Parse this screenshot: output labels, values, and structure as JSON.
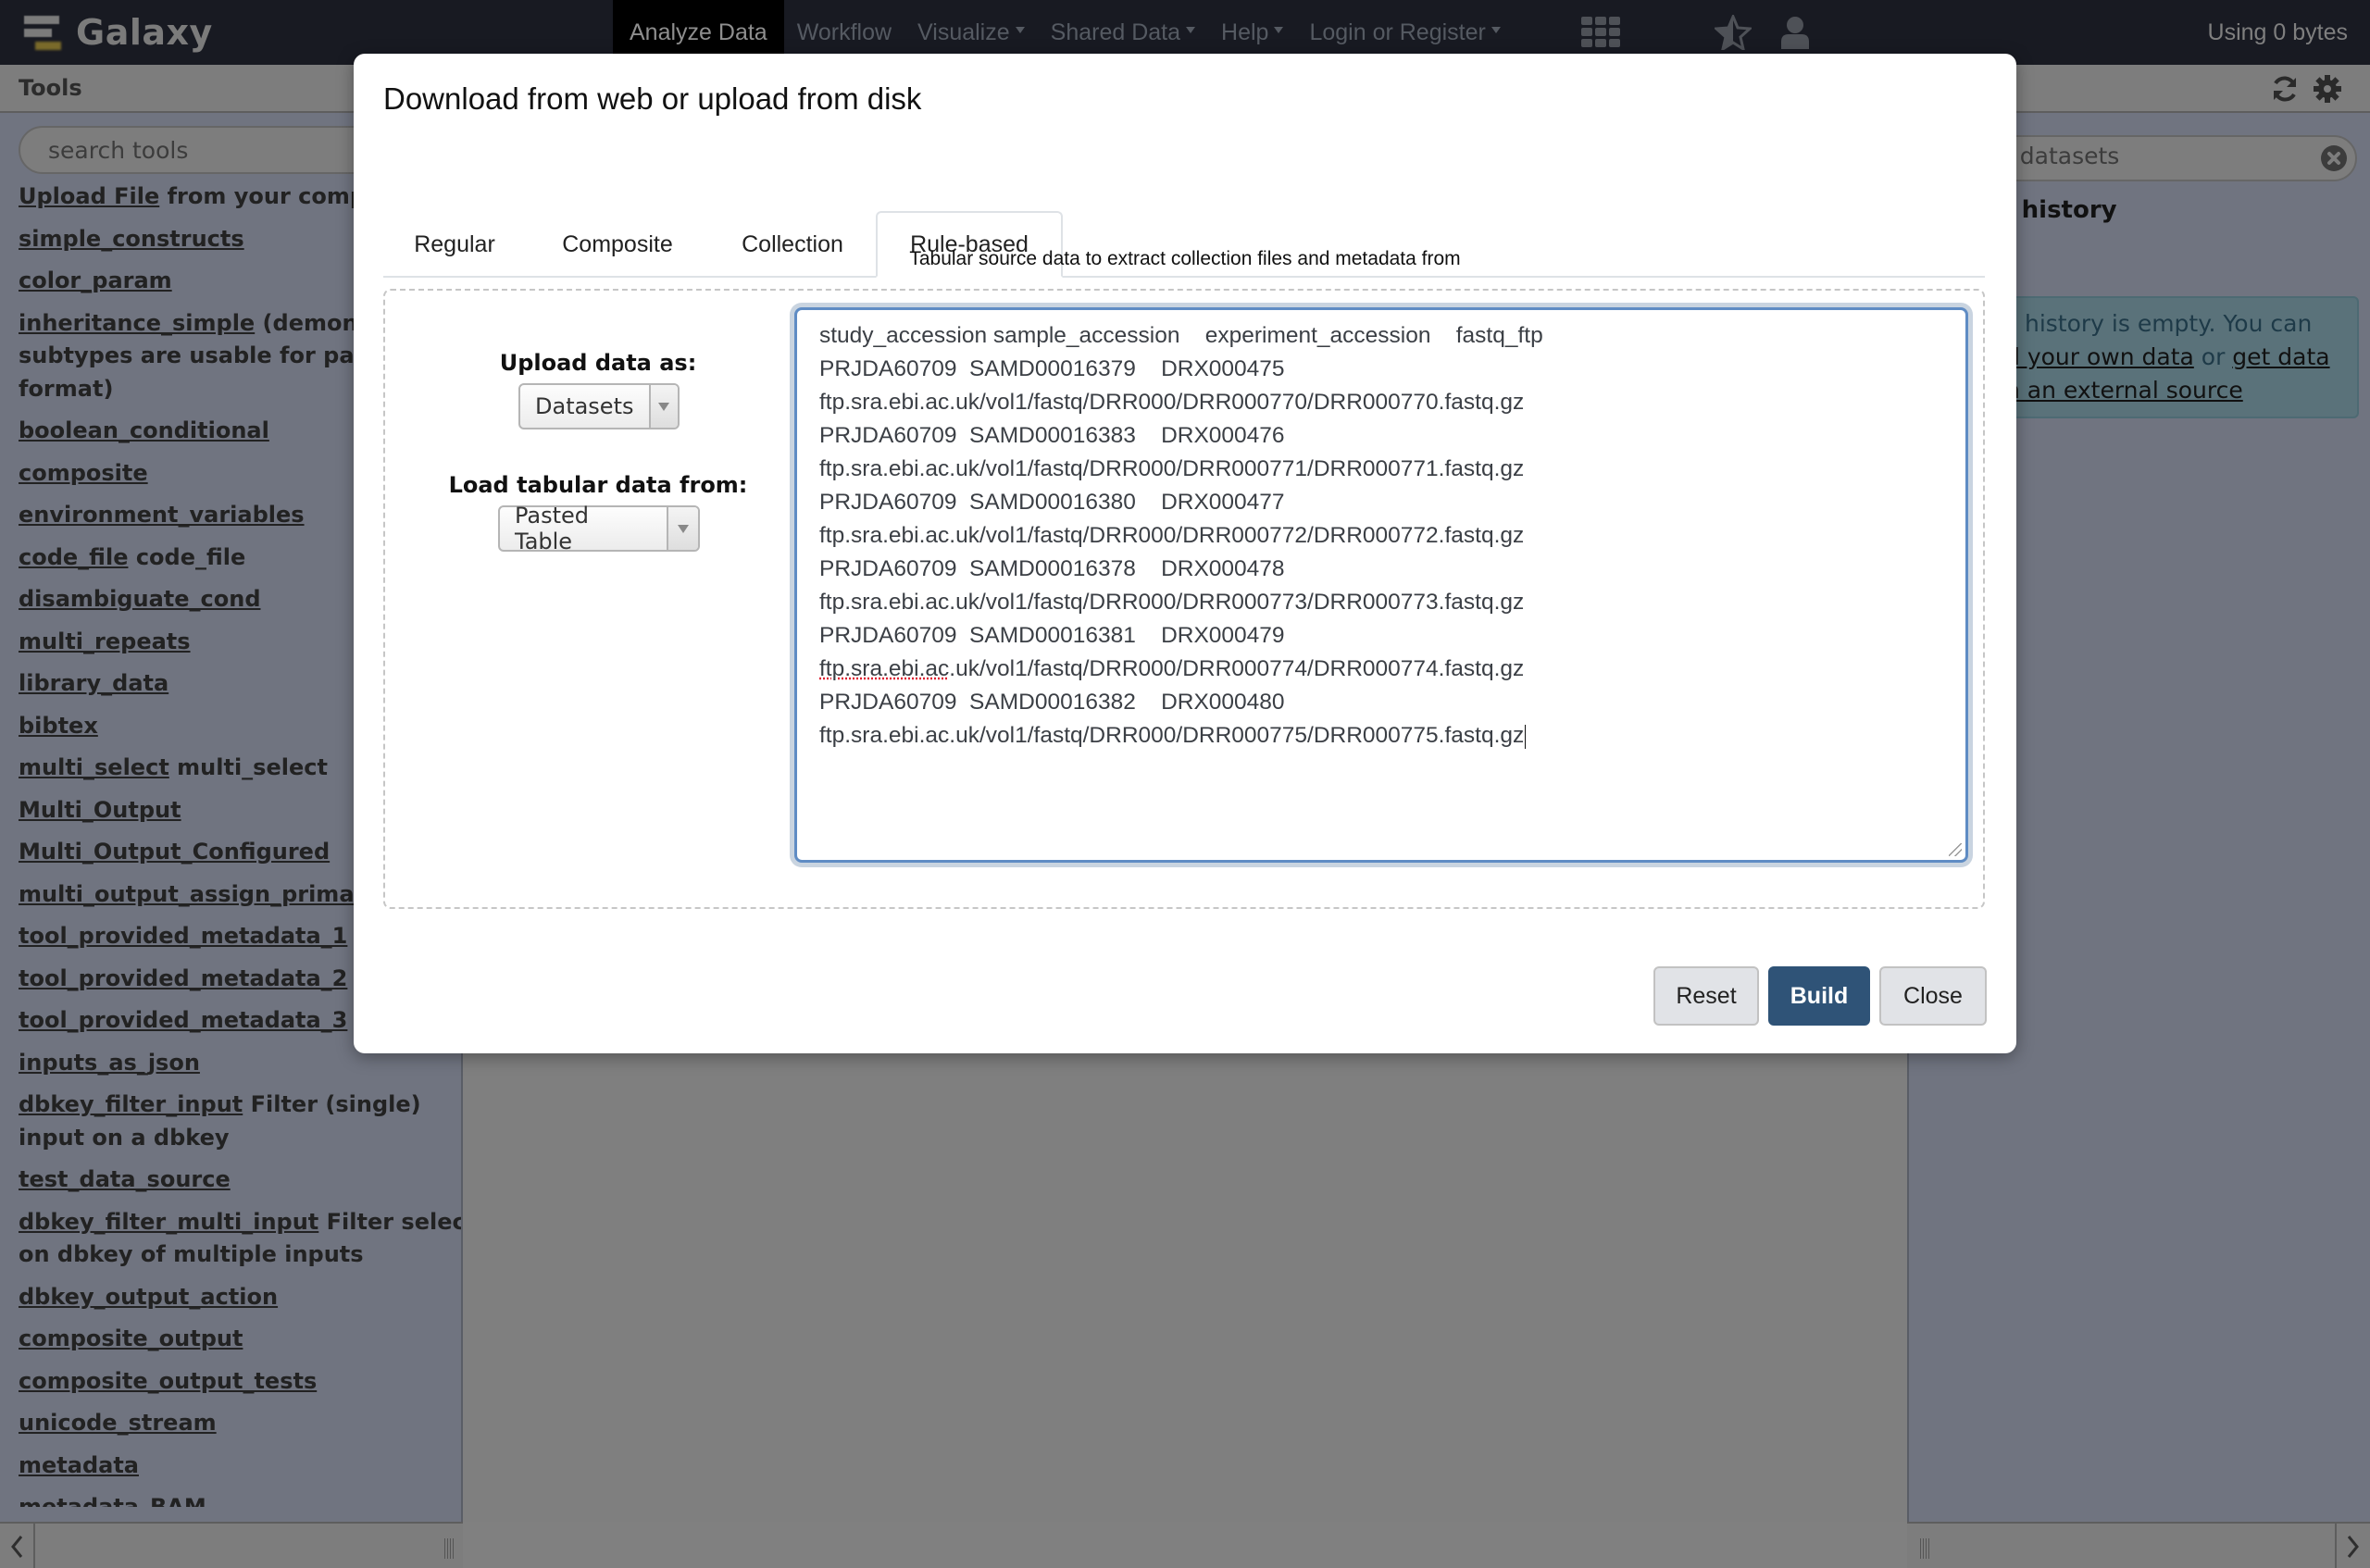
{
  "masthead": {
    "brand": "Galaxy",
    "nav": [
      {
        "label": "Analyze Data",
        "active": true,
        "dropdown": false
      },
      {
        "label": "Workflow",
        "active": false,
        "dropdown": false
      },
      {
        "label": "Visualize",
        "active": false,
        "dropdown": true
      },
      {
        "label": "Shared Data",
        "active": false,
        "dropdown": true
      },
      {
        "label": "Help",
        "active": false,
        "dropdown": true
      },
      {
        "label": "Login or Register",
        "active": false,
        "dropdown": true
      }
    ],
    "icons": [
      "grid-icon",
      "star-icon",
      "user-icon"
    ],
    "quota": "Using 0 bytes"
  },
  "tool_panel": {
    "title": "Tools",
    "search_placeholder": "search tools",
    "items": [
      {
        "link": "Upload File",
        "desc": " from your compu"
      },
      {
        "link": "simple_constructs",
        "desc": ""
      },
      {
        "link": "color_param",
        "desc": ""
      },
      {
        "link": "inheritance_simple",
        "desc": " (demonstr",
        "desc2": "subtypes are usable for parer",
        "desc3": "format)"
      },
      {
        "link": "boolean_conditional",
        "desc": ""
      },
      {
        "link": "composite",
        "desc": ""
      },
      {
        "link": "environment_variables",
        "desc": ""
      },
      {
        "link": "code_file",
        "desc": " code_file"
      },
      {
        "link": "disambiguate_cond",
        "desc": ""
      },
      {
        "link": "multi_repeats",
        "desc": ""
      },
      {
        "link": "library_data",
        "desc": ""
      },
      {
        "link": "bibtex",
        "desc": ""
      },
      {
        "link": "multi_select",
        "desc": " multi_select"
      },
      {
        "link": "Multi_Output",
        "desc": ""
      },
      {
        "link": "Multi_Output_Configured",
        "desc": ""
      },
      {
        "link": "multi_output_assign_primary",
        "desc": ""
      },
      {
        "link": "tool_provided_metadata_1",
        "desc": ""
      },
      {
        "link": "tool_provided_metadata_2",
        "desc": ""
      },
      {
        "link": "tool_provided_metadata_3",
        "desc": ""
      },
      {
        "link": "inputs_as_json",
        "desc": ""
      },
      {
        "link": "dbkey_filter_input",
        "desc": " Filter (single)",
        "desc2": "input on a dbkey"
      },
      {
        "link": "test_data_source",
        "desc": ""
      },
      {
        "link": "dbkey_filter_multi_input",
        "desc": " Filter select",
        "desc2": "on dbkey of multiple inputs"
      },
      {
        "link": "dbkey_output_action",
        "desc": ""
      },
      {
        "link": "composite_output",
        "desc": ""
      },
      {
        "link": "composite_output_tests",
        "desc": ""
      },
      {
        "link": "unicode_stream",
        "desc": ""
      },
      {
        "link": "metadata",
        "desc": ""
      },
      {
        "link": "metadata_BAM",
        "desc": ""
      }
    ]
  },
  "history_panel": {
    "search_placeholder_visible": "n datasets",
    "history_name_visible": "d history",
    "empty_message": {
      "line1": "s history is empty. You can",
      "line2_link1": "d your own data",
      "line2_mid": " or ",
      "line2_link2": "get data",
      "line3_link": "n an external source"
    }
  },
  "modal": {
    "title": "Download from web or upload from disk",
    "tabs": [
      {
        "label": "Regular",
        "active": false
      },
      {
        "label": "Composite",
        "active": false
      },
      {
        "label": "Collection",
        "active": false
      },
      {
        "label": "Rule-based",
        "active": true
      }
    ],
    "subtitle": "Tabular source data to extract collection files and metadata from",
    "upload_as_label": "Upload data as:",
    "upload_as_value": "Datasets",
    "load_from_label": "Load tabular data from:",
    "load_from_value": "Pasted Table",
    "pasted_lines": [
      "study_accession sample_accession    experiment_accession    fastq_ftp",
      "PRJDA60709  SAMD00016379    DRX000475",
      "ftp.sra.ebi.ac.uk/vol1/fastq/DRR000/DRR000770/DRR000770.fastq.gz",
      "PRJDA60709  SAMD00016383    DRX000476",
      "ftp.sra.ebi.ac.uk/vol1/fastq/DRR000/DRR000771/DRR000771.fastq.gz",
      "PRJDA60709  SAMD00016380    DRX000477",
      "ftp.sra.ebi.ac.uk/vol1/fastq/DRR000/DRR000772/DRR000772.fastq.gz",
      "PRJDA60709  SAMD00016378    DRX000478",
      "ftp.sra.ebi.ac.uk/vol1/fastq/DRR000/DRR000773/DRR000773.fastq.gz",
      "PRJDA60709  SAMD00016381    DRX000479",
      "ftp.sra.ebi.ac.uk/vol1/fastq/DRR000/DRR000774/DRR000774.fastq.gz",
      "PRJDA60709  SAMD00016382    DRX000480",
      "ftp.sra.ebi.ac.uk/vol1/fastq/DRR000/DRR000775/DRR000775.fastq.gz"
    ],
    "spellcheck_flagged": "ftp.sra.ebi.ac",
    "buttons": {
      "reset": "Reset",
      "build": "Build",
      "close": "Close"
    },
    "colors": {
      "build_bg": "#2f5377",
      "textarea_focus": "#5f8cc4"
    }
  }
}
